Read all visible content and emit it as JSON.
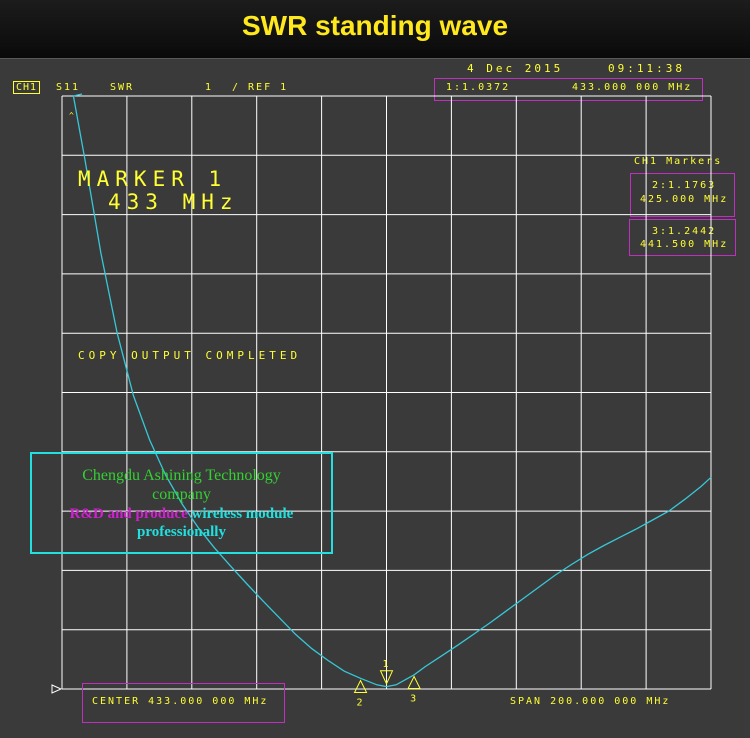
{
  "banner": {
    "title": "SWR standing wave"
  },
  "header": {
    "channel": "CH1",
    "measure": "S11",
    "format": "SWR",
    "scale": "1",
    "ref": "/ REF 1",
    "date": "4 Dec 2015",
    "time": "09:11:38",
    "marker1_readout": "1:1.0372",
    "marker1_freq": "433.000 000 MHz"
  },
  "markers_panel": {
    "title": "CH1 Markers",
    "m2_value": "2:1.1763",
    "m2_freq": "425.000 MHz",
    "m3_value": "3:1.2442",
    "m3_freq": "441.500 MHz"
  },
  "marker_label": {
    "line1": "MARKER 1",
    "line2": "433 MHz"
  },
  "status": "COPY OUTPUT COMPLETED",
  "footer": {
    "center": "CENTER 433.000 000 MHz",
    "span": "SPAN 200.000 000 MHz"
  },
  "company": {
    "line1": "Chengdu Ashining Technology",
    "line2": "company",
    "line3_part1": "R&D and produce",
    "line3_part2": " wireless module",
    "line4": "professionally"
  },
  "colors": {
    "trace": "#36c8d8",
    "grid": "#ffffff",
    "text": "#ffff33",
    "highlight": "#c030c0",
    "accent": "#22e0e0"
  },
  "chart_data": {
    "type": "line",
    "title": "SWR standing wave",
    "xlabel": "",
    "ylabel": "",
    "xlim": [
      333,
      533
    ],
    "ylim": [
      1,
      11
    ],
    "grid": true,
    "series": [
      {
        "values_x": [
          336.5,
          340,
          345,
          350,
          355,
          360,
          365,
          370,
          375,
          380,
          385,
          390,
          395,
          400,
          405,
          410,
          415,
          420,
          425,
          430,
          433,
          436,
          441.5,
          445,
          450,
          455,
          460,
          465,
          470,
          475,
          480,
          485,
          490,
          495,
          500,
          505,
          510,
          515,
          520,
          525,
          530,
          533
        ],
        "values_y": [
          11.0,
          9.95,
          8.35,
          7.0,
          5.95,
          5.2,
          4.6,
          4.12,
          3.72,
          3.38,
          3.07,
          2.77,
          2.48,
          2.2,
          1.92,
          1.68,
          1.48,
          1.3,
          1.18,
          1.07,
          1.04,
          1.07,
          1.24,
          1.38,
          1.56,
          1.74,
          1.93,
          2.12,
          2.32,
          2.52,
          2.72,
          2.92,
          3.1,
          3.27,
          3.42,
          3.56,
          3.7,
          3.85,
          4.0,
          4.2,
          4.42,
          4.57
        ]
      }
    ],
    "markers": [
      {
        "id": "1",
        "x": 433.0,
        "y": 1.0372
      },
      {
        "id": "2",
        "x": 425.0,
        "y": 1.1763
      },
      {
        "id": "3",
        "x": 441.5,
        "y": 1.2442
      }
    ]
  }
}
